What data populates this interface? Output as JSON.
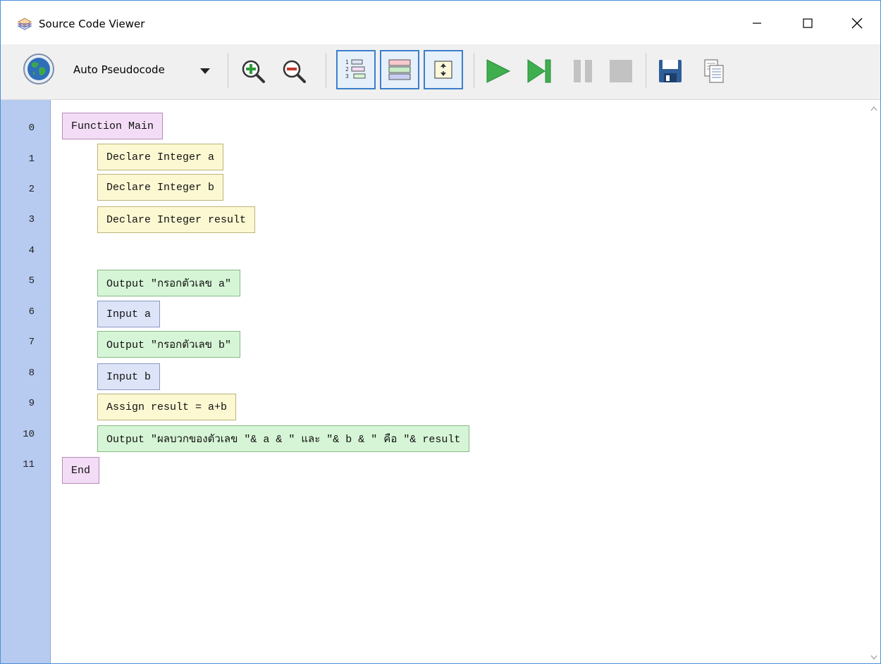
{
  "window": {
    "title": "Source Code Viewer"
  },
  "toolbar": {
    "mode_label": "Auto Pseudocode",
    "icons": {
      "globe": "globe-icon",
      "dropdown": "chevron-down-icon",
      "zoom_in": "zoom-in-icon",
      "zoom_out": "zoom-out-icon",
      "line_numbers": "line-numbers-icon",
      "colors": "color-blocks-icon",
      "expand": "expand-icon",
      "run": "play-icon",
      "step": "step-icon",
      "pause": "pause-icon",
      "stop": "stop-icon",
      "save": "save-icon",
      "copy": "copy-icon"
    }
  },
  "code": {
    "line_numbers": [
      "0",
      "1",
      "2",
      "3",
      "4",
      "5",
      "6",
      "7",
      "8",
      "9",
      "10",
      "11"
    ],
    "lines": [
      {
        "text": "Function Main",
        "kind": "function"
      },
      {
        "text": "Declare Integer a",
        "kind": "declare"
      },
      {
        "text": "Declare Integer b",
        "kind": "declare"
      },
      {
        "text": "Declare Integer result",
        "kind": "declare"
      },
      {
        "text": "",
        "kind": "blank"
      },
      {
        "text": "Output \"กรอกตัวเลข a\"",
        "kind": "output"
      },
      {
        "text": "Input a",
        "kind": "input"
      },
      {
        "text": "Output \"กรอกตัวเลข b\"",
        "kind": "output"
      },
      {
        "text": "Input b",
        "kind": "input"
      },
      {
        "text": "Assign result = a+b",
        "kind": "assign"
      },
      {
        "text": "Output \"ผลบวกของตัวเลข \"& a & \" และ \"& b & \" คือ \"& result",
        "kind": "output"
      },
      {
        "text": "End",
        "kind": "function"
      }
    ]
  },
  "colors": {
    "gutter": "#b7caf0",
    "function_block": "#f3ddf6",
    "declare_block": "#fcf8d2",
    "output_block": "#d6f5d6",
    "input_block": "#dde4f8",
    "accent": "#3d7ec9"
  }
}
